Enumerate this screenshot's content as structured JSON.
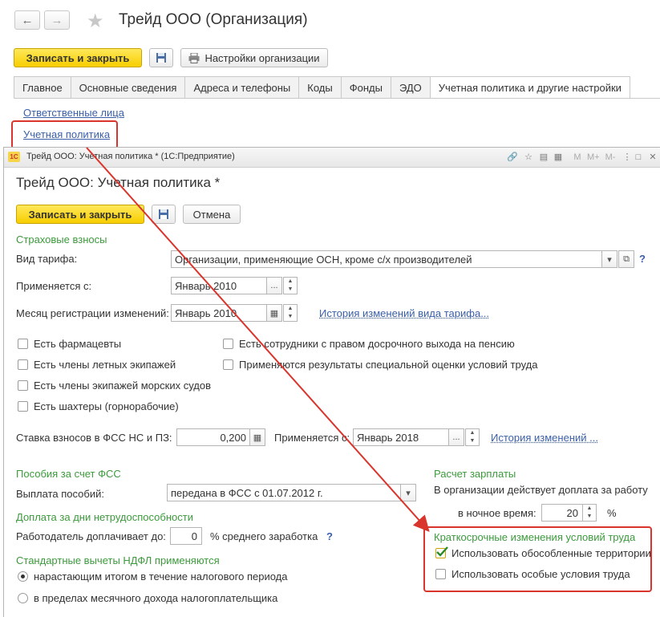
{
  "top": {
    "back_glyph": "←",
    "forward_glyph": "→",
    "title": "Трейд ООО (Организация)",
    "save_close": "Записать и закрыть",
    "org_settings": "Настройки организации",
    "tabs": [
      "Главное",
      "Основные сведения",
      "Адреса и телефоны",
      "Коды",
      "Фонды",
      "ЭДО",
      "Учетная политика и другие настройки"
    ],
    "link_responsible": "Ответственные лица",
    "link_policy": "Учетная политика"
  },
  "win": {
    "caption": "Трейд ООО: Учетная политика * (1С:Предприятие)",
    "logo": "1С",
    "title": "Трейд ООО: Учетная политика *",
    "save_close": "Записать и закрыть",
    "cancel": "Отмена",
    "m_buttons": [
      "M",
      "M+",
      "M-"
    ],
    "section_insurance": "Страховые взносы",
    "tariff_label": "Вид тарифа:",
    "tariff_value": "Организации, применяющие ОСН, кроме с/х производителей",
    "applies_label": "Применяется с:",
    "applies_value": "Январь 2010",
    "month_reg_label": "Месяц регистрации изменений:",
    "month_reg_value": "Январь 2010",
    "tariff_history": "История изменений вида тарифа...",
    "checkboxes_left": [
      "Есть фармацевты",
      "Есть члены летных экипажей",
      "Есть члены экипажей морских судов",
      "Есть шахтеры (горнорабочие)"
    ],
    "checkboxes_right": [
      "Есть сотрудники с правом досрочного выхода на пенсию",
      "Применяются результаты специальной оценки условий труда"
    ],
    "fss_rate_label": "Ставка взносов в ФСС НС и ПЗ:",
    "fss_rate_value": "0,200",
    "fss_applies_label": "Применяется с:",
    "fss_applies_value": "Январь 2018",
    "fss_history": "История изменений ...",
    "section_benefits": "Пособия за счет ФСС",
    "benefits_label": "Выплата пособий:",
    "benefits_value": "передана в ФСС с 01.07.2012 г.",
    "section_sick_topup": "Доплата за дни нетрудоспособности",
    "employer_topup_label": "Работодатель доплачивает до:",
    "employer_topup_value": "0",
    "employer_topup_suffix": "% среднего заработка",
    "section_ndfl": "Стандартные вычеты НДФЛ применяются",
    "ndfl_options": [
      "нарастающим итогом в течение налогового периода",
      "в пределах месячного дохода налогоплательщика"
    ],
    "section_payroll": "Расчет зарплаты",
    "payroll_text": "В организации действует доплата за работу",
    "night_label": "в ночное время:",
    "night_value": "20",
    "night_unit": "%",
    "section_short": "Краткосрочные изменения условий труда",
    "short_options": [
      "Использовать обособленные территории",
      "Использовать особые условия труда"
    ],
    "short_checked": [
      true,
      false
    ],
    "help": "?"
  },
  "colors": {
    "accent_green": "#3c9a3c",
    "link_blue": "#3a5fa8",
    "highlight_red": "#d9352c",
    "button_yellow": "#f7ce00"
  }
}
